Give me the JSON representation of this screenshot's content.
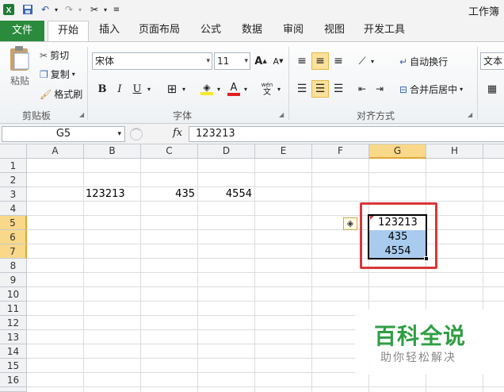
{
  "app": {
    "title": "工作簿"
  },
  "ribbon_tabs": [
    "文件",
    "开始",
    "插入",
    "页面布局",
    "公式",
    "数据",
    "审阅",
    "视图",
    "开发工具"
  ],
  "clipboard": {
    "paste": "粘贴",
    "cut": "剪切",
    "copy": "复制",
    "format_painter": "格式刷",
    "label": "剪贴板"
  },
  "font": {
    "name": "宋体",
    "size": "11",
    "label": "字体",
    "bold": "B",
    "italic": "I",
    "underline": "U"
  },
  "alignment": {
    "wrap_text": "自动换行",
    "merge_center": "合并后居中",
    "label": "对齐方式"
  },
  "number": {
    "format": "文本"
  },
  "formula_bar": {
    "name_box": "G5",
    "fx": "fx",
    "value": "123213"
  },
  "columns": [
    "A",
    "B",
    "C",
    "D",
    "E",
    "F",
    "G",
    "H"
  ],
  "rows": [
    "1",
    "2",
    "3",
    "4",
    "5",
    "6",
    "7",
    "8",
    "9",
    "10",
    "11",
    "12",
    "13",
    "14",
    "15",
    "16"
  ],
  "cells": {
    "B3": "123213",
    "C3": "435",
    "D3": "4554",
    "G5": "123213",
    "G6": "435",
    "G7": "4554"
  },
  "watermark": {
    "title": "百科全说",
    "subtitle": "助你轻松解决"
  },
  "colors": {
    "file_tab": "#2a8b3c",
    "selection": "#a9cbee",
    "highlight_box": "#d9363a",
    "active_header": "#f9d889"
  }
}
